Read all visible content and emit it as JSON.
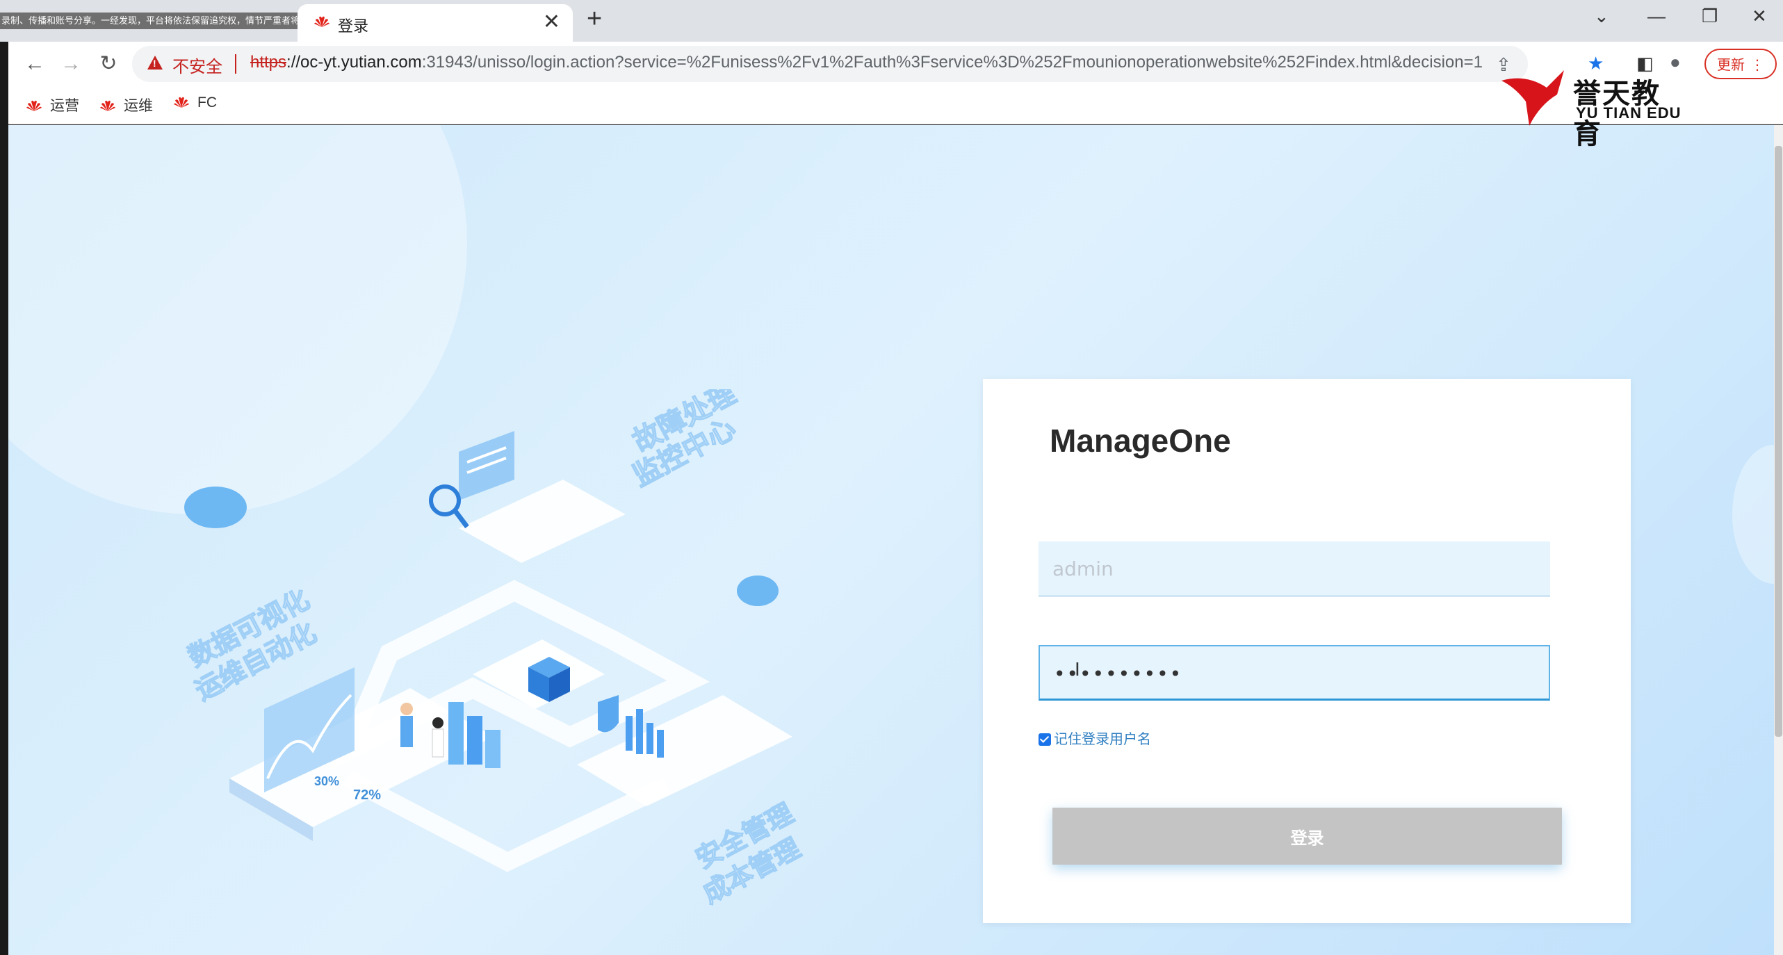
{
  "browser": {
    "watermark": "录制、传播和账号分享。一经发现，平台将依法保留追究权，情节严重者将承担法律责任。",
    "tab_active_title": "登录",
    "security_label": "不安全",
    "url_scheme": "https",
    "url_host": "://oc-yt.yutian.com",
    "url_rest": ":31943/unisso/login.action?service=%2Funisess%2Fv1%2Fauth%3Fservice%3D%252Fmounionoperationwebsite%252Findex.html&decision=1",
    "update_label": "更新",
    "bookmarks": [
      "运营",
      "运维",
      "FC"
    ]
  },
  "logo": {
    "cn": "誉天教育",
    "en": "YU TIAN EDU"
  },
  "illustration": {
    "text_fault": "故障处理",
    "text_monitor": "监控中心",
    "text_data": "数据可视化",
    "text_ops": "运维自动化",
    "text_security": "安全管理",
    "text_cost": "成本管理",
    "pct_a": "30%",
    "pct_b": "72%"
  },
  "login": {
    "product_name": "ManageOne",
    "username_value": "admin",
    "password_mask": "••••••••••",
    "remember_label": "记住登录用户名",
    "submit_label": "登录"
  },
  "colors": {
    "accent": "#2f96d6",
    "danger": "#c5221f",
    "button_disabled": "#c4c4c4"
  }
}
